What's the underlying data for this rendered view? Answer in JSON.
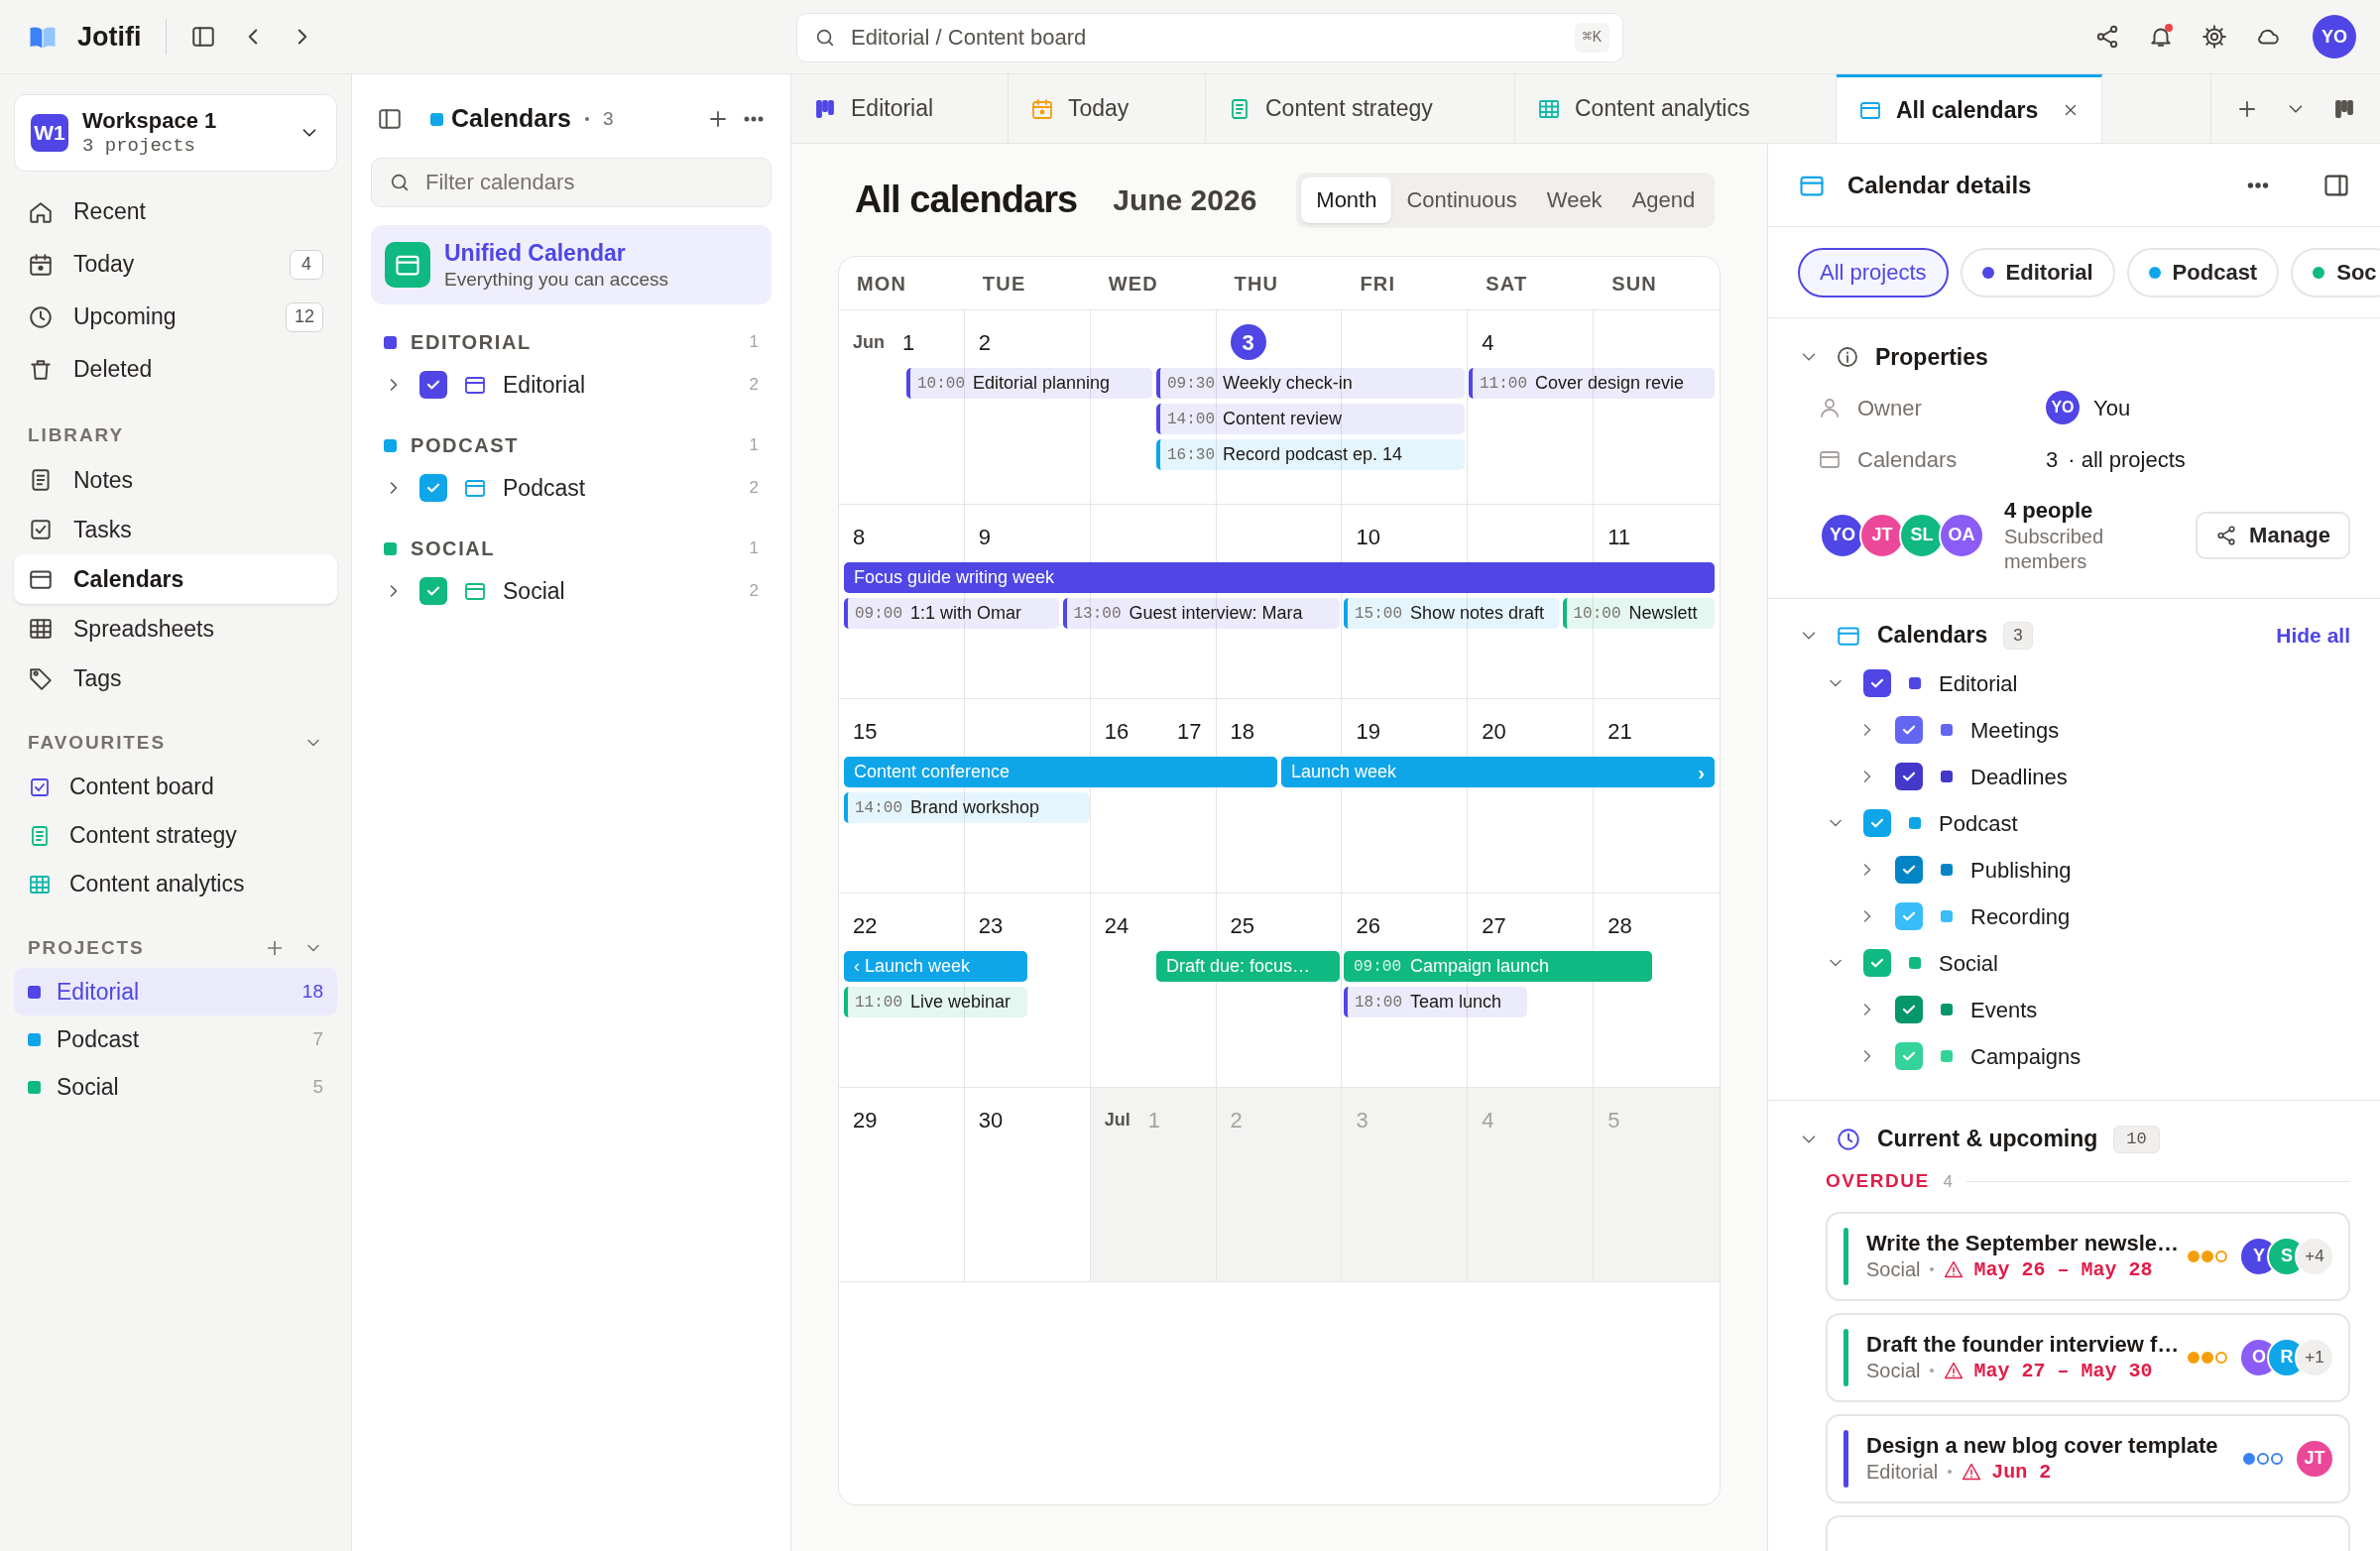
{
  "app": {
    "name": "Jotifi"
  },
  "search": {
    "placeholder": "Editorial / Content board",
    "shortcut": "⌘K"
  },
  "user_avatar": "YO",
  "workspace": {
    "badge": "W1",
    "name": "Workspace 1",
    "subtitle": "3 projects"
  },
  "nav": [
    {
      "label": "Recent"
    },
    {
      "label": "Today",
      "count": "4"
    },
    {
      "label": "Upcoming",
      "count": "12"
    },
    {
      "label": "Deleted"
    }
  ],
  "library": {
    "heading": "LIBRARY",
    "items": [
      {
        "label": "Notes",
        "selected": false
      },
      {
        "label": "Tasks",
        "selected": false
      },
      {
        "label": "Calendars",
        "selected": true
      },
      {
        "label": "Spreadsheets",
        "selected": false
      },
      {
        "label": "Tags",
        "selected": false
      }
    ]
  },
  "favourites": {
    "heading": "FAVOURITES",
    "items": [
      {
        "label": "Content board",
        "color": "#4f46e5"
      },
      {
        "label": "Content strategy",
        "color": "#10b981"
      },
      {
        "label": "Content analytics",
        "color": "#14b8a6"
      }
    ]
  },
  "projects": {
    "heading": "PROJECTS",
    "items": [
      {
        "label": "Editorial",
        "count": "18",
        "color": "#4f46e5",
        "selected": true
      },
      {
        "label": "Podcast",
        "count": "7",
        "color": "#0ea5e9",
        "selected": false
      },
      {
        "label": "Social",
        "count": "5",
        "color": "#10b981",
        "selected": false
      }
    ]
  },
  "calendars_panel": {
    "title": "Calendars",
    "count": "3",
    "filter_placeholder": "Filter calendars",
    "unified": {
      "title": "Unified Calendar",
      "subtitle": "Everything you can access"
    },
    "groups": [
      {
        "heading": "EDITORIAL",
        "count": "1",
        "color": "#4f46e5",
        "calendar": {
          "label": "Editorial",
          "count": "2",
          "checked": true
        }
      },
      {
        "heading": "PODCAST",
        "count": "1",
        "color": "#0ea5e9",
        "calendar": {
          "label": "Podcast",
          "count": "2",
          "checked": true
        }
      },
      {
        "heading": "SOCIAL",
        "count": "1",
        "color": "#10b981",
        "calendar": {
          "label": "Social",
          "count": "2",
          "checked": true
        }
      }
    ]
  },
  "tabs": [
    {
      "label": "Editorial",
      "color": "#4f46e5",
      "selected": false
    },
    {
      "label": "Today",
      "color": "#f59e0b",
      "selected": false
    },
    {
      "label": "Content strategy",
      "color": "#10b981",
      "selected": false
    },
    {
      "label": "Content analytics",
      "color": "#14b8a6",
      "selected": false
    },
    {
      "label": "All calendars",
      "color": "#0ea5e9",
      "selected": true
    }
  ],
  "calendar": {
    "title": "All calendars",
    "month": "June 2026",
    "views": [
      {
        "label": "Month",
        "selected": true
      },
      {
        "label": "Continuous",
        "selected": false
      },
      {
        "label": "Week",
        "selected": false
      },
      {
        "label": "Agend",
        "selected": false
      }
    ],
    "weekdays": [
      "MON",
      "TUE",
      "WED",
      "THU",
      "FRI",
      "SAT",
      "SUN"
    ],
    "weeks": [
      {
        "cells": [
          {
            "month_label": "Jun",
            "days": [
              "1"
            ]
          },
          {
            "days": [
              "2"
            ]
          },
          {},
          {
            "days": [
              "3"
            ],
            "today": true
          },
          {},
          {
            "days": [
              "4"
            ]
          },
          {}
        ],
        "lanes": [
          [
            {
              "kind": "chip",
              "time": "10:00",
              "title": "Editorial planning",
              "color": "#4f46e5"
            },
            {
              "kind": "chip",
              "time": "09:30",
              "title": "Weekly check-in",
              "color": "#4f46e5"
            },
            {
              "kind": "chip",
              "time": "11:00",
              "title": "Cover design revie",
              "color": "#4f46e5"
            }
          ],
          [
            {
              "kind": "chip",
              "time": "14:00",
              "title": "Content review",
              "color": "#4f46e5"
            }
          ],
          [
            {
              "kind": "chip",
              "time": "16:30",
              "title": "Record podcast ep. 14",
              "color": "#0ea5e9"
            }
          ]
        ]
      },
      {
        "cells": [
          {
            "days": [
              "8"
            ]
          },
          {
            "days": [
              "9"
            ]
          },
          {},
          {},
          {
            "days": [
              "10"
            ]
          },
          {},
          {
            "days": [
              "11"
            ]
          }
        ],
        "lanes": [
          [
            {
              "kind": "bar",
              "title": "Focus guide writing week",
              "color": "#4f46e5"
            }
          ],
          [
            {
              "kind": "chip",
              "time": "09:00",
              "title": "1:1 with Omar",
              "color": "#4f46e5"
            },
            {
              "kind": "chip",
              "time": "13:00",
              "title": "Guest interview: Mara",
              "color": "#4f46e5"
            },
            {
              "kind": "chip",
              "time": "15:00",
              "title": "Show notes draft",
              "color": "#0ea5e9"
            },
            {
              "kind": "chip",
              "time": "10:00",
              "title": "Newslett",
              "color": "#10b981"
            }
          ]
        ]
      },
      {
        "cells": [
          {
            "days": [
              "15"
            ]
          },
          {},
          {
            "days": [
              "16",
              "17"
            ]
          },
          {
            "days": [
              "18"
            ]
          },
          {
            "days": [
              "19"
            ]
          },
          {
            "days": [
              "20"
            ]
          },
          {
            "days": [
              "21"
            ]
          }
        ],
        "lanes": [
          [
            {
              "kind": "bar",
              "title": "Content conference",
              "color": "#0ea5e9"
            },
            {
              "kind": "bar",
              "title": "Launch week",
              "arrow": "›",
              "color": "#0ea5e9"
            }
          ],
          [
            {
              "kind": "chip",
              "time": "14:00",
              "title": "Brand workshop",
              "color": "#0ea5e9"
            }
          ]
        ]
      },
      {
        "cells": [
          {
            "days": [
              "22"
            ]
          },
          {
            "days": [
              "23"
            ]
          },
          {
            "days": [
              "24"
            ]
          },
          {
            "days": [
              "25"
            ]
          },
          {
            "days": [
              "26"
            ]
          },
          {
            "days": [
              "27"
            ]
          },
          {
            "days": [
              "28"
            ]
          }
        ],
        "lanes": [
          [
            {
              "kind": "bar",
              "title": "‹ Launch week",
              "color": "#0ea5e9"
            },
            {
              "kind": "bar",
              "title": "Draft due: focus…",
              "color": "#10b981"
            },
            {
              "kind": "bar",
              "time": "09:00",
              "title": "Campaign launch",
              "color": "#10b981"
            }
          ],
          [
            {
              "kind": "chip",
              "time": "11:00",
              "title": "Live webinar",
              "color": "#10b981"
            },
            {
              "kind": "chip",
              "time": "18:00",
              "title": "Team lunch",
              "color": "#4f46e5"
            }
          ]
        ]
      },
      {
        "cells": [
          {
            "days": [
              "29"
            ]
          },
          {
            "days": [
              "30"
            ]
          },
          {
            "month_label": "Jul",
            "days": [
              "1"
            ],
            "outside": true
          },
          {
            "days": [
              "2"
            ],
            "outside": true
          },
          {
            "days": [
              "3"
            ],
            "outside": true
          },
          {
            "days": [
              "4"
            ],
            "outside": true
          },
          {
            "days": [
              "5"
            ],
            "outside": true
          }
        ]
      }
    ]
  },
  "details": {
    "title": "Calendar details",
    "filters": [
      {
        "label": "All projects",
        "selected": true
      },
      {
        "label": "Editorial",
        "color": "#4f46e5",
        "selected": false
      },
      {
        "label": "Podcast",
        "color": "#0ea5e9",
        "selected": false
      },
      {
        "label": "Soc",
        "color": "#10b981",
        "selected": false
      }
    ],
    "properties": {
      "heading": "Properties",
      "owner_label": "Owner",
      "owner_avatar": "YO",
      "owner": "You",
      "calendars_label": "Calendars",
      "calendars_count": "3",
      "calendars_scope": "· all projects"
    },
    "members": {
      "avatars": [
        {
          "initials": "YO",
          "color": "#4f46e5"
        },
        {
          "initials": "JT",
          "color": "#ec4899"
        },
        {
          "initials": "SL",
          "color": "#10b981"
        },
        {
          "initials": "OA",
          "color": "#8b5cf6"
        }
      ],
      "count": "4 people",
      "caption": "Subscribed members",
      "button": "Manage"
    },
    "calendars": {
      "heading": "Calendars",
      "count": "3",
      "action": "Hide all",
      "tree": [
        {
          "label": "Editorial",
          "color": "#4f46e5",
          "checked": true,
          "expanded": true,
          "children": [
            {
              "label": "Meetings",
              "color": "#6366f1",
              "checked": true,
              "expanded": false
            },
            {
              "label": "Deadlines",
              "color": "#4338ca",
              "checked": true,
              "expanded": false
            }
          ]
        },
        {
          "label": "Podcast",
          "color": "#0ea5e9",
          "checked": true,
          "expanded": true,
          "children": [
            {
              "label": "Publishing",
              "color": "#0284c7",
              "checked": true,
              "expanded": false
            },
            {
              "label": "Recording",
              "color": "#38bdf8",
              "checked": true,
              "expanded": false
            }
          ]
        },
        {
          "label": "Social",
          "color": "#10b981",
          "checked": true,
          "expanded": true,
          "children": [
            {
              "label": "Events",
              "color": "#059669",
              "checked": true,
              "expanded": false
            },
            {
              "label": "Campaigns",
              "color": "#34d399",
              "checked": true,
              "expanded": false
            }
          ]
        }
      ]
    },
    "upcoming": {
      "heading": "Current & upcoming",
      "count": "10",
      "section": "OVERDUE",
      "section_count": "4",
      "tasks": [
        {
          "title": "Write the September newsle…",
          "project": "Social",
          "dates": "May 26 – May 28",
          "color": "#10b981",
          "stars": 2,
          "assignees": [
            {
              "initials": "Y",
              "color": "#4f46e5"
            },
            {
              "initials": "S",
              "color": "#10b981"
            }
          ],
          "more": "+4"
        },
        {
          "title": "Draft the founder interview f…",
          "project": "Social",
          "dates": "May 27 – May 30",
          "color": "#10b981",
          "stars": 2,
          "assignees": [
            {
              "initials": "O",
              "color": "#8b5cf6"
            },
            {
              "initials": "R",
              "color": "#0ea5e9"
            }
          ],
          "more": "+1"
        },
        {
          "title": "Design a new blog cover template",
          "project": "Editorial",
          "dates": "Jun 2",
          "color": "#4f46e5",
          "stars": 1,
          "assignees": [
            {
              "initials": "JT",
              "color": "#ec4899"
            }
          ]
        }
      ]
    }
  }
}
